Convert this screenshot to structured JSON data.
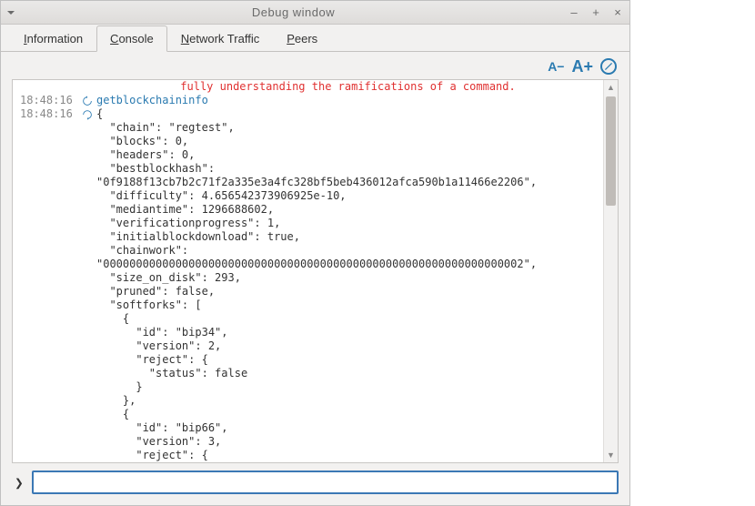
{
  "window": {
    "title": "Debug window",
    "min_icon": "–",
    "max_icon": "+",
    "close_icon": "×"
  },
  "tabs": {
    "info": {
      "label_pre": "",
      "ul": "I",
      "label_post": "nformation"
    },
    "console": {
      "label_pre": "",
      "ul": "C",
      "label_post": "onsole"
    },
    "network": {
      "label_pre": "",
      "ul": "N",
      "label_post": "etwork Traffic"
    },
    "peers": {
      "label_pre": "",
      "ul": "P",
      "label_post": "eers"
    },
    "active": "console"
  },
  "tool": {
    "font_small": "A−",
    "font_large": "A+",
    "clear": "⊘"
  },
  "console": {
    "warn_line": "fully understanding the ramifications of a command.",
    "cmd_ts": "18:48:16",
    "cmd_text": "getblockchaininfo",
    "resp_ts": "18:48:16",
    "resp_text": "{\n  \"chain\": \"regtest\",\n  \"blocks\": 0,\n  \"headers\": 0,\n  \"bestblockhash\":\n\"0f9188f13cb7b2c71f2a335e3a4fc328bf5beb436012afca590b1a11466e2206\",\n  \"difficulty\": 4.656542373906925e-10,\n  \"mediantime\": 1296688602,\n  \"verificationprogress\": 1,\n  \"initialblockdownload\": true,\n  \"chainwork\":\n\"0000000000000000000000000000000000000000000000000000000000000002\",\n  \"size_on_disk\": 293,\n  \"pruned\": false,\n  \"softforks\": [\n    {\n      \"id\": \"bip34\",\n      \"version\": 2,\n      \"reject\": {\n        \"status\": false\n      }\n    },\n    {\n      \"id\": \"bip66\",\n      \"version\": 3,\n      \"reject\": {"
  },
  "input": {
    "prompt": "❯",
    "value": ""
  }
}
